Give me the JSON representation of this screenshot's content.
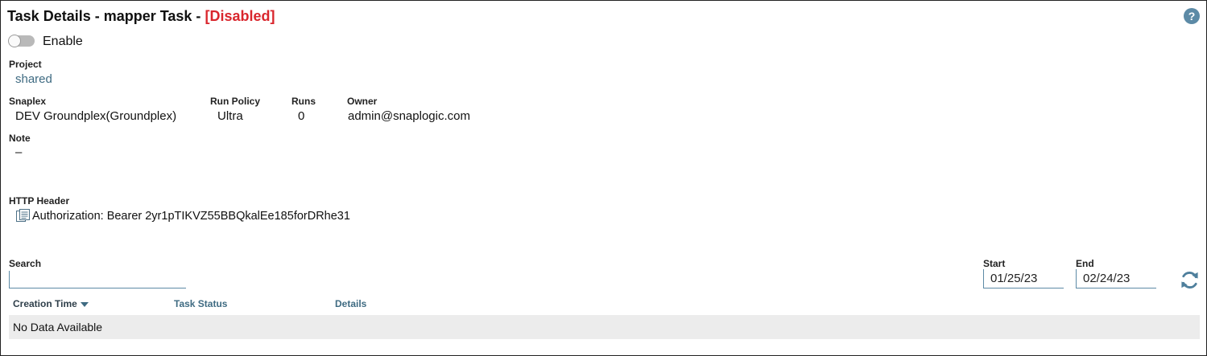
{
  "header": {
    "title": "Task Details - mapper Task -",
    "status": "[Disabled]",
    "help_icon": "help-circle-icon",
    "help_glyph": "?"
  },
  "enable": {
    "label": "Enable",
    "checked": false
  },
  "project": {
    "label": "Project",
    "value": "shared"
  },
  "snaplex": {
    "label": "Snaplex",
    "value": "DEV Groundplex(Groundplex)"
  },
  "run_policy": {
    "label": "Run Policy",
    "value": "Ultra"
  },
  "runs": {
    "label": "Runs",
    "value": "0"
  },
  "owner": {
    "label": "Owner",
    "value": "admin@snaplogic.com"
  },
  "note": {
    "label": "Note",
    "value": "–"
  },
  "http_header": {
    "label": "HTTP Header",
    "icon": "table-list-icon",
    "value": "Authorization: Bearer 2yr1pTIKVZ55BBQkalEe185forDRhe31"
  },
  "search": {
    "label": "Search",
    "value": ""
  },
  "start": {
    "label": "Start",
    "value": "01/25/23"
  },
  "end": {
    "label": "End",
    "value": "02/24/23"
  },
  "refresh_icon": "refresh-icon",
  "table": {
    "columns": [
      "Creation Time",
      "Task Status",
      "Details"
    ],
    "sorted_column": "Creation Time",
    "sort_direction": "descending",
    "empty_text": "No Data Available"
  },
  "colors": {
    "accent": "#3f6b82",
    "status_disabled": "#d9262d",
    "empty_row_bg": "#ececec"
  }
}
